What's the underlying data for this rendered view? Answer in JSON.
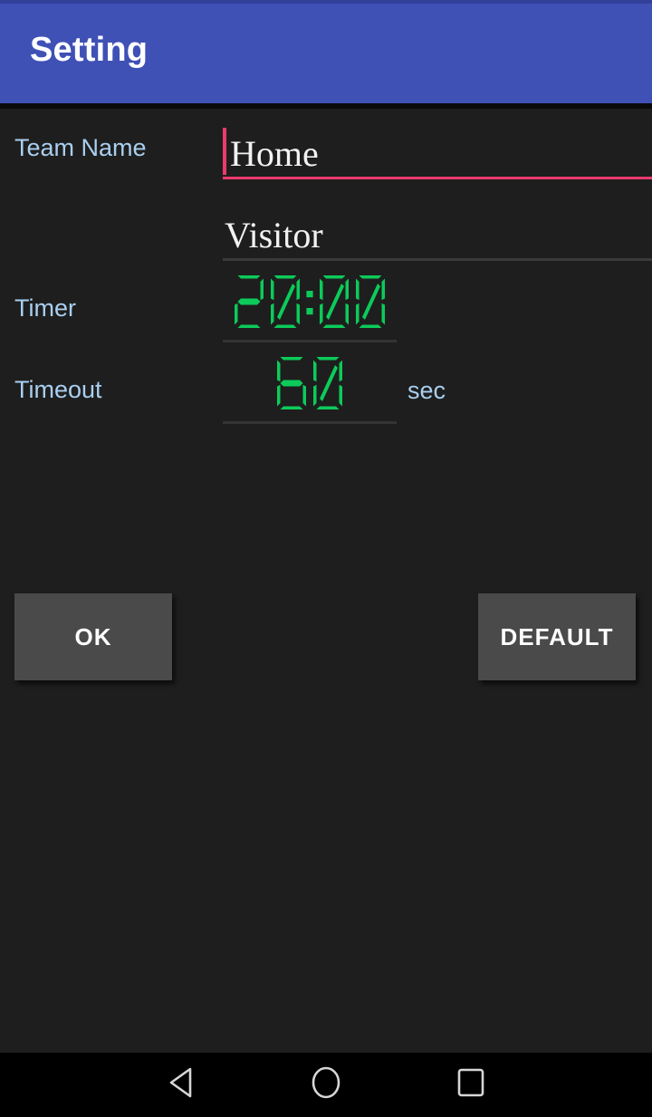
{
  "window": {
    "app_bar_title": "Setting",
    "app_bar_color": "#3f51b5",
    "background_color": "#1e1e1e"
  },
  "colors": {
    "accent_pink": "#ec3a6e",
    "label_blue": "#a9cff0",
    "digital_green": "#0ccb5a",
    "button_fill": "#4a4a4a",
    "field_text": "#f2f2f2"
  },
  "form": {
    "team_name": {
      "label": "Team Name",
      "home": {
        "value": "Home",
        "placeholder": "Home",
        "focused": true
      },
      "visitor": {
        "value": "Visitor",
        "placeholder": "Visitor",
        "focused": false
      }
    },
    "timer": {
      "label": "Timer",
      "value": "20:00",
      "placeholder": "20:00"
    },
    "timeout": {
      "label": "Timeout",
      "value": "60",
      "placeholder": "60",
      "unit": "sec"
    }
  },
  "actions": {
    "ok_label": "OK",
    "default_label": "DEFAULT"
  },
  "navbar": {
    "back_icon": "back-triangle-icon",
    "home_icon": "home-circle-icon",
    "recents_icon": "recents-square-icon"
  }
}
